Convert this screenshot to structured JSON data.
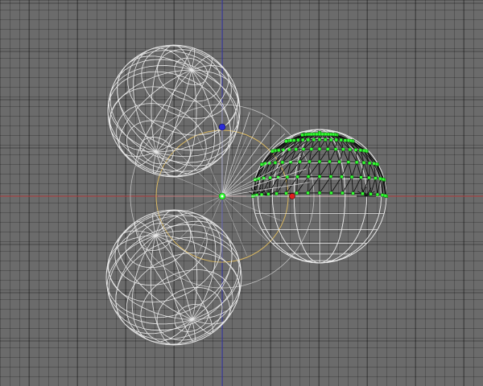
{
  "viewport": {
    "view": "orthographic-top",
    "background_color": "#6b6b6b",
    "grid": true,
    "wire_color": "#e8e8e8",
    "selected_edge_color": "#101010",
    "vertex_color": "#33ff33",
    "x_axis_color": "#b03a3a",
    "y_axis_color": "#3a3ab0",
    "circle_color": "#d9b760",
    "icons": [
      "pivot-icon",
      "blue-handle-icon",
      "red-handle-icon"
    ]
  }
}
